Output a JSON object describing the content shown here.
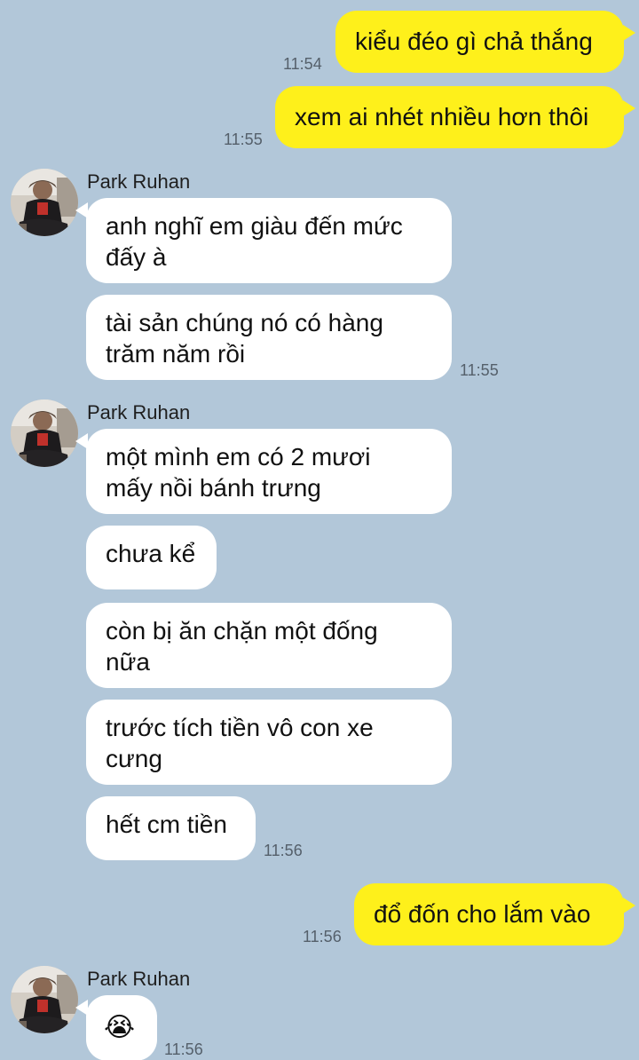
{
  "chat": {
    "sender_name": "Park Ruhan",
    "avatar_icon": "profile-photo",
    "messages": {
      "m1": {
        "text": "kiểu đéo gì chả thắng",
        "time": "11:54"
      },
      "m2": {
        "text": "xem ai nhét nhiều hơn thôi",
        "time": "11:55"
      },
      "m3": {
        "text": "anh nghĩ em giàu đến mức\nđấy à"
      },
      "m4": {
        "text": "tài sản chúng nó có hàng\ntrăm năm rồi",
        "time": "11:55"
      },
      "m5": {
        "text": "một mình em có 2 mươi\nmấy nồi bánh trưng"
      },
      "m6": {
        "text": "chưa kể"
      },
      "m7": {
        "text": "còn bị ăn chặn một đống\nnữa"
      },
      "m8": {
        "text": "trước tích tiền vô con xe\ncưng"
      },
      "m9": {
        "text": "hết cm tiền",
        "time": "11:56"
      },
      "m10": {
        "text": "đổ đốn cho lắm vào",
        "time": "11:56"
      },
      "m11": {
        "text": "😭",
        "time": "11:56"
      }
    }
  },
  "colors": {
    "background": "#b2c7d9",
    "my_bubble": "#fef01b",
    "their_bubble": "#ffffff",
    "timestamp": "#55606b"
  }
}
